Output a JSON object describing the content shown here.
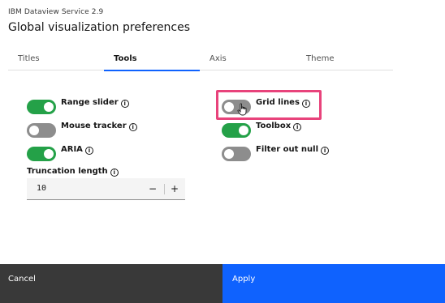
{
  "header": {
    "product": "IBM Dataview Service 2.9",
    "title": "Global visualization preferences"
  },
  "tabs": [
    {
      "label": "Titles",
      "active": false
    },
    {
      "label": "Tools",
      "active": true
    },
    {
      "label": "Axis",
      "active": false
    },
    {
      "label": "Theme",
      "active": false
    }
  ],
  "options": {
    "range_slider": {
      "label": "Range slider",
      "on": true
    },
    "mouse_tracker": {
      "label": "Mouse tracker",
      "on": false
    },
    "aria": {
      "label": "ARIA",
      "on": true
    },
    "grid_lines": {
      "label": "Grid lines",
      "on": false
    },
    "toolbox": {
      "label": "Toolbox",
      "on": true
    },
    "filter_out_null": {
      "label": "Filter out null",
      "on": false
    }
  },
  "truncation": {
    "label": "Truncation length",
    "value": "10",
    "minus": "−",
    "plus": "+"
  },
  "icons": {
    "info": "i"
  },
  "colors": {
    "toggle_on": "#24a148",
    "toggle_off": "#8d8d8d",
    "accent": "#0f62fe",
    "highlight": "#e8437b"
  },
  "footer": {
    "cancel": "Cancel",
    "apply": "Apply"
  }
}
